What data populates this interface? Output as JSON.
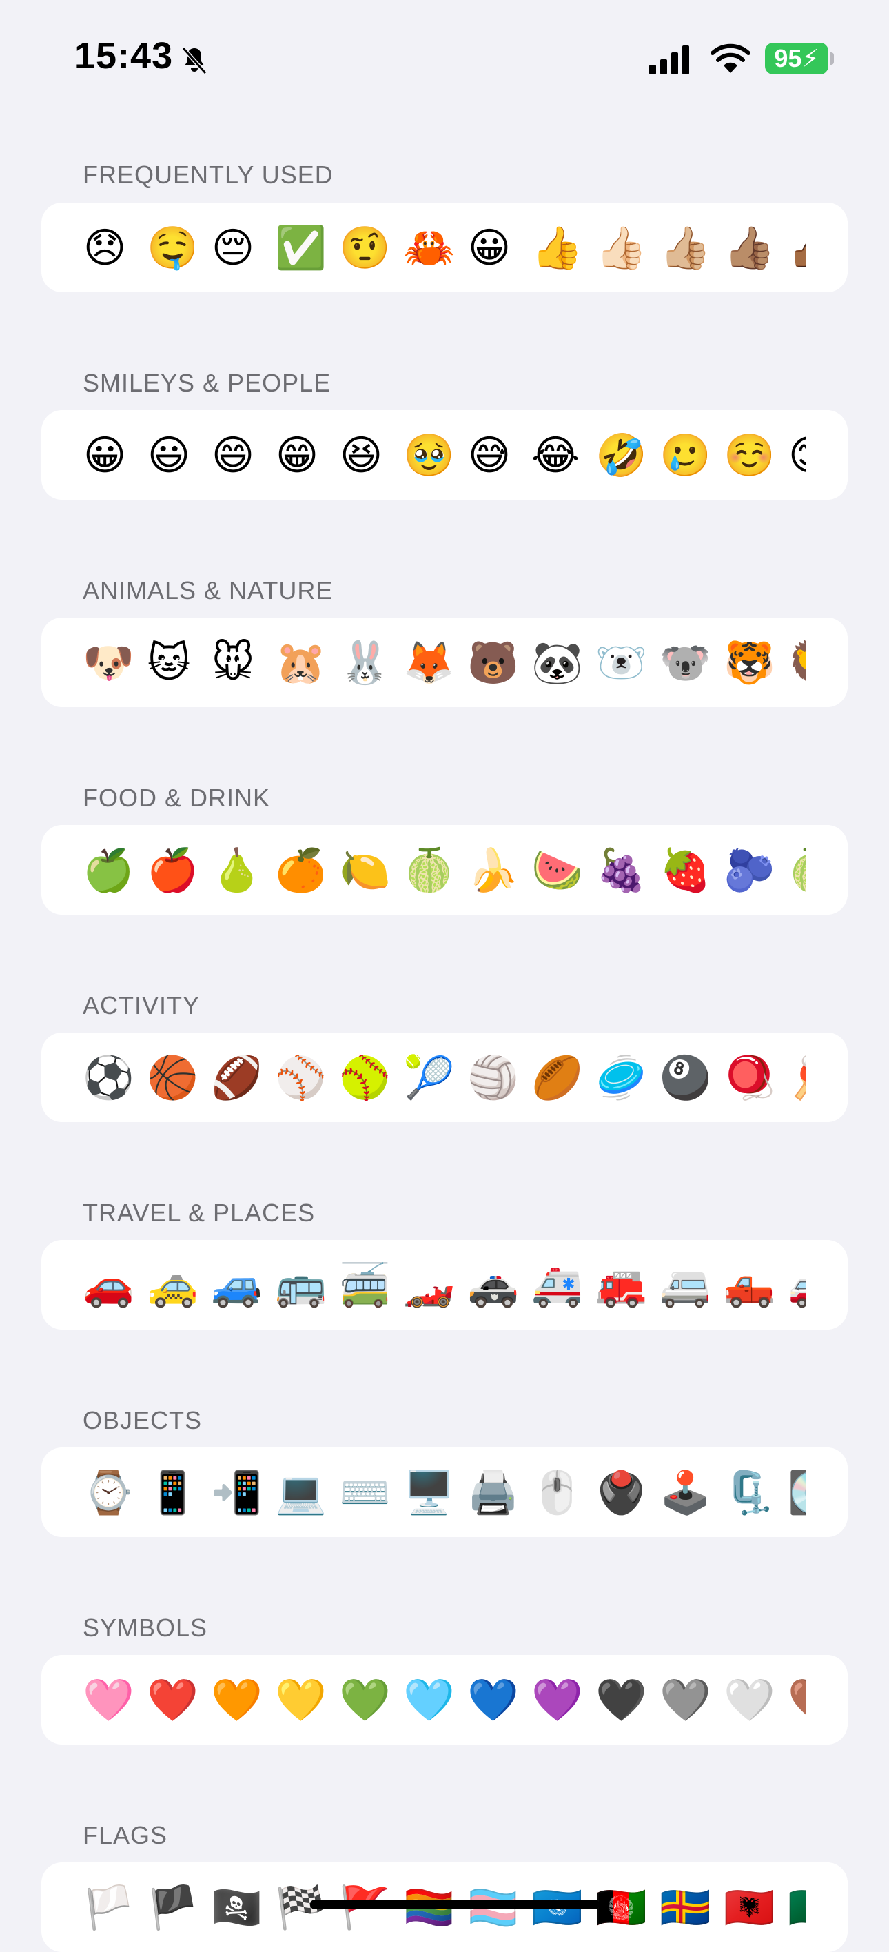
{
  "status": {
    "time": "15:43",
    "battery": "95"
  },
  "sections": [
    {
      "title": "FREQUENTLY USED",
      "emojis": [
        "😞",
        "🤤",
        "😔",
        "✅",
        "🤨",
        "🦀",
        "😀",
        "👍",
        "👍🏻",
        "👍🏼",
        "👍🏽",
        "👍🏾"
      ]
    },
    {
      "title": "SMILEYS & PEOPLE",
      "emojis": [
        "😀",
        "😃",
        "😄",
        "😁",
        "😆",
        "🥹",
        "😅",
        "😂",
        "🤣",
        "🥲",
        "☺️",
        "😊"
      ]
    },
    {
      "title": "ANIMALS & NATURE",
      "emojis": [
        "🐶",
        "🐱",
        "🐭",
        "🐹",
        "🐰",
        "🦊",
        "🐻",
        "🐼",
        "🐻‍❄️",
        "🐨",
        "🐯",
        "🦁"
      ]
    },
    {
      "title": "FOOD & DRINK",
      "emojis": [
        "🍏",
        "🍎",
        "🍐",
        "🍊",
        "🍋",
        "🍈",
        "🍌",
        "🍉",
        "🍇",
        "🍓",
        "🫐",
        "🍈"
      ]
    },
    {
      "title": "ACTIVITY",
      "emojis": [
        "⚽",
        "🏀",
        "🏈",
        "⚾",
        "🥎",
        "🎾",
        "🏐",
        "🏉",
        "🥏",
        "🎱",
        "🪀",
        "🏓"
      ]
    },
    {
      "title": "TRAVEL & PLACES",
      "emojis": [
        "🚗",
        "🚕",
        "🚙",
        "🚌",
        "🚎",
        "🏎️",
        "🚓",
        "🚑",
        "🚒",
        "🚐",
        "🛻",
        "🚚"
      ]
    },
    {
      "title": "OBJECTS",
      "emojis": [
        "⌚",
        "📱",
        "📲",
        "💻",
        "⌨️",
        "🖥️",
        "🖨️",
        "🖱️",
        "🖲️",
        "🕹️",
        "🗜️",
        "💽"
      ]
    },
    {
      "title": "SYMBOLS",
      "emojis": [
        "🩷",
        "❤️",
        "🧡",
        "💛",
        "💚",
        "🩵",
        "💙",
        "💜",
        "🖤",
        "🩶",
        "🤍",
        "🤎"
      ]
    },
    {
      "title": "FLAGS",
      "emojis": [
        "🏳️",
        "🏴",
        "🏴‍☠️",
        "🏁",
        "🚩",
        "🏳️‍🌈",
        "🏳️‍⚧️",
        "🇺🇳",
        "🇦🇫",
        "🇦🇽",
        "🇦🇱",
        "🇩🇿"
      ]
    }
  ]
}
